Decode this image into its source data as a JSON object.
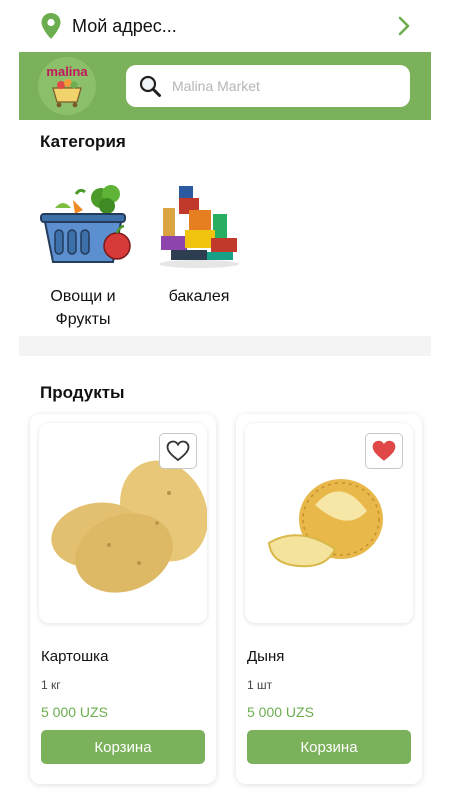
{
  "address": {
    "label": "Мой адрес..."
  },
  "header": {
    "logo_text": "malina"
  },
  "search": {
    "placeholder": "Malina Market"
  },
  "categories": {
    "title": "Категория",
    "items": [
      {
        "label_line1": "Овощи и",
        "label_line2": "Фрукты"
      },
      {
        "label_line1": "бакалея",
        "label_line2": ""
      }
    ]
  },
  "products": {
    "title": "Продукты",
    "items": [
      {
        "name": "Картошка",
        "unit": "1 кг",
        "price": "5 000 UZS",
        "cart_label": "Корзина",
        "favorite": false
      },
      {
        "name": "Дыня",
        "unit": "1 шт",
        "price": "5 000 UZS",
        "cart_label": "Корзина",
        "favorite": true
      }
    ]
  },
  "colors": {
    "accent": "#7bb15a",
    "price": "#6cae4f",
    "favorite": "#e04848"
  }
}
